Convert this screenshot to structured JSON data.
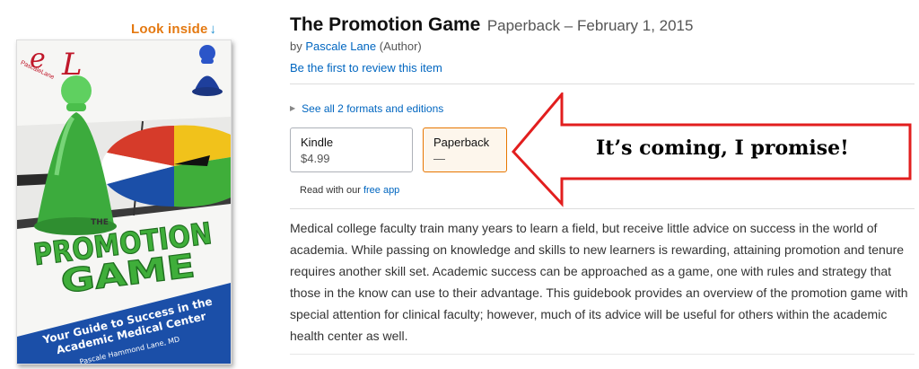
{
  "look_inside": {
    "label": "Look inside",
    "arrow": "↓"
  },
  "cover": {
    "logo_text": "PascaleLane",
    "header_word": "THE",
    "title_line1": "PROMOTION",
    "title_line2": "GAME",
    "subtitle_line1": "Your Guide to Success in the",
    "subtitle_line2": "Academic Medical Center",
    "author": "Pascale Hammond Lane, MD"
  },
  "product": {
    "title": "The Promotion Game",
    "binding_date": "Paperback – February 1, 2015",
    "by": "by",
    "author": "Pascale Lane",
    "author_role": "(Author)",
    "review_prompt": "Be the first to review this item"
  },
  "formats": {
    "see_all": "See all 2 formats and editions",
    "options": [
      {
        "label": "Kindle",
        "price": "$4.99"
      },
      {
        "label": "Paperback",
        "price": "—"
      }
    ],
    "read_with": "Read with our",
    "free_app": "free app"
  },
  "annotation": {
    "text": "It’s coming, I promise!"
  },
  "description": "Medical college faculty train many years to learn a field, but receive little advice on success in the world of academia. While passing on knowledge and skills to new learners is rewarding, attaining promotion and tenure requires another skill set. Academic success can be approached as a game, one with rules and strategy that those in the know can use to their advantage. This guidebook provides an overview of the promotion game with special attention for clinical faculty; however, much of its advice will be useful for others within the academic health center as well.",
  "colors": {
    "link": "#0066c0",
    "look_inside": "#e47911",
    "selected_border": "#e77600",
    "callout_arrow": "#e21e1e",
    "cover_title_green": "#3fae3a",
    "cover_banner_blue": "#1b4fa8"
  }
}
